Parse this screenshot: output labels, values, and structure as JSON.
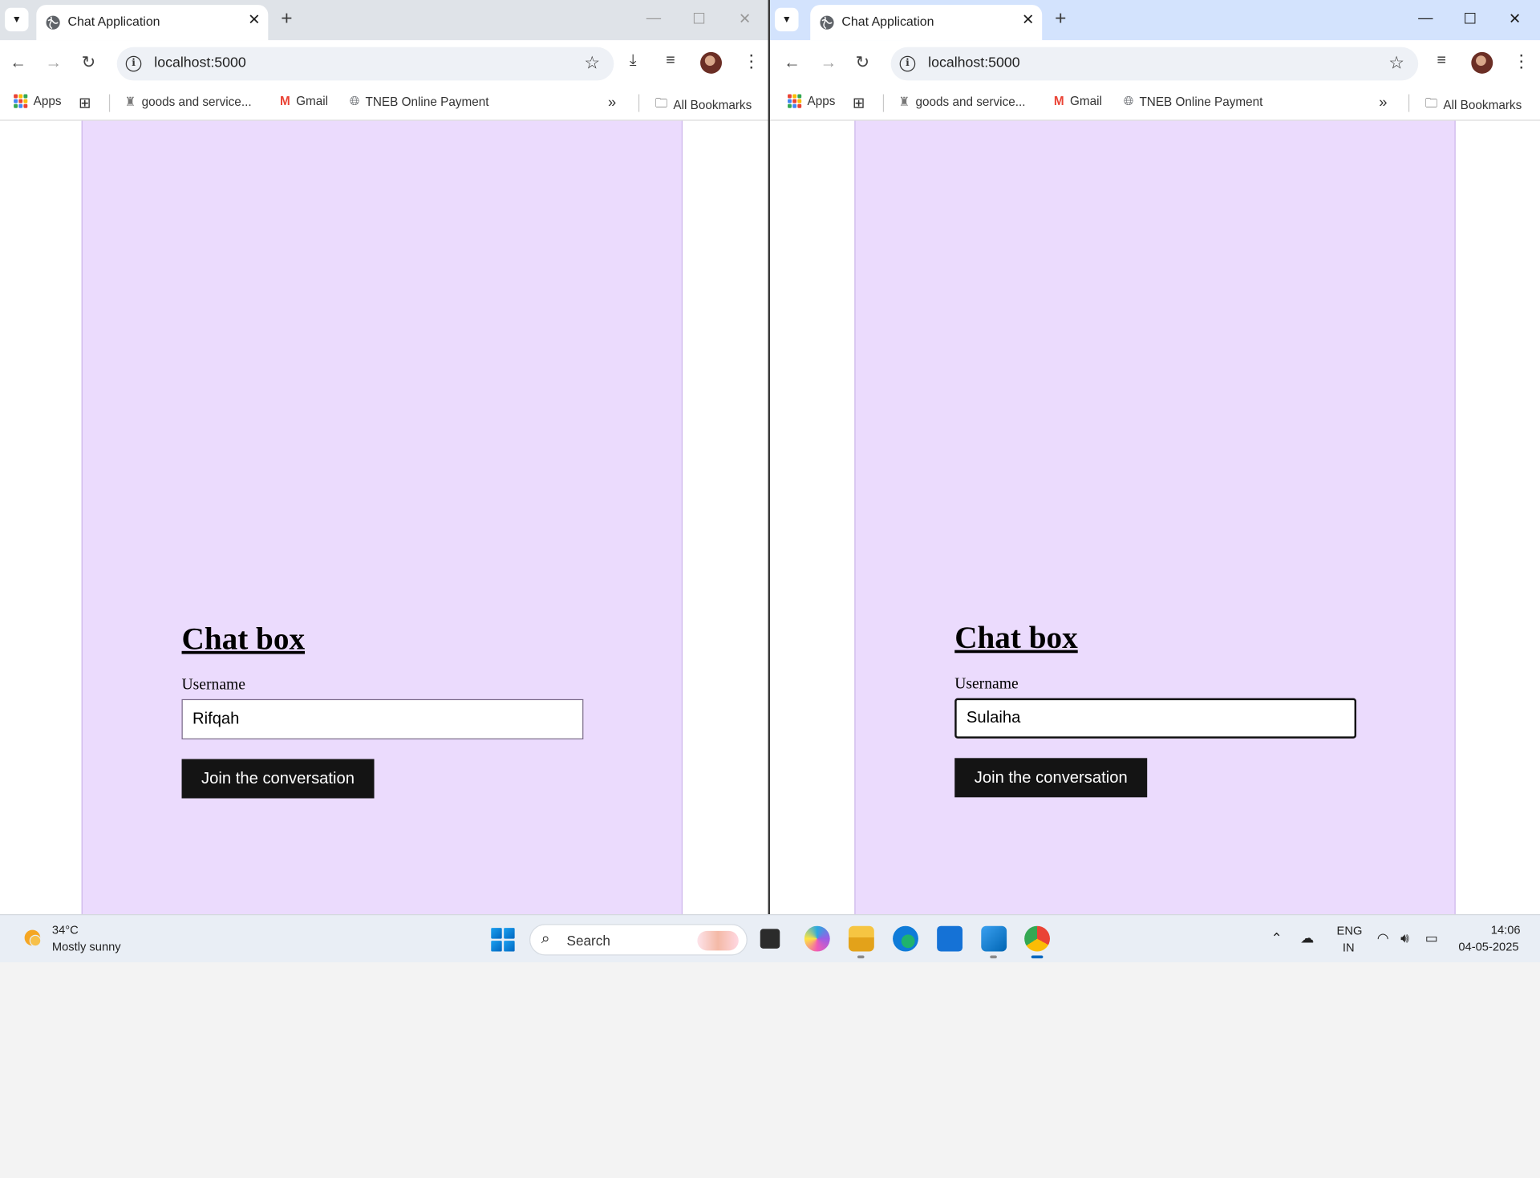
{
  "browser": {
    "tab_title": "Chat Application",
    "url": "localhost:5000",
    "bookmarks": {
      "apps": "Apps",
      "goods": "goods and service...",
      "gmail": "Gmail",
      "tneb": "TNEB Online Payment",
      "all": "All Bookmarks"
    }
  },
  "left_window": {
    "heading": "Chat box",
    "username_label": "Username",
    "username_value": "Rifqah",
    "join_label": "Join the conversation"
  },
  "right_window": {
    "heading": "Chat box",
    "username_label": "Username",
    "username_value": "Sulaiha",
    "join_label": "Join the conversation"
  },
  "taskbar": {
    "weather_temp": "34°C",
    "weather_desc": "Mostly sunny",
    "search_label": "Search",
    "lang_line1": "ENG",
    "lang_line2": "IN",
    "time": "14:06",
    "date": "04-05-2025"
  },
  "colors": {
    "chat_panel_bg": "#ebdbfd",
    "join_button_bg": "#141414",
    "right_tabstrip": "#d3e3fd",
    "left_tabstrip": "#dfe3e8"
  }
}
